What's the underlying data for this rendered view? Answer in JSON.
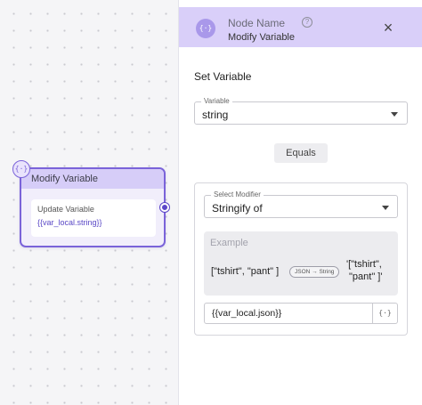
{
  "canvas": {
    "node": {
      "badge_icon": "{·}",
      "title": "Modify Variable",
      "body_label": "Update Variable",
      "body_value": "{{var_local.string}}"
    }
  },
  "panel": {
    "header": {
      "icon": "{·}",
      "title": "Node Name",
      "help_icon": "?",
      "subtitle": "Modify Variable",
      "close_icon": "×"
    },
    "section_title": "Set Variable",
    "variable_field": {
      "legend": "Variable",
      "value": "string"
    },
    "equals_label": "Equals",
    "modifier_field": {
      "legend": "Select Modifier",
      "value": "Stringify of"
    },
    "example": {
      "title": "Example",
      "input": "[\"tshirt\", \"pant\" ]",
      "transform": "JSON → String",
      "output_line1": "'[\"tshirt\",",
      "output_line2": "\"pant\" ]'"
    },
    "json_input_value": "{{var_local.json}}",
    "json_btn_icon": "{·}"
  },
  "colors": {
    "accent": "#7a63d9",
    "header_bg": "#d9cff9",
    "node_header_bg": "#d6cdf8"
  }
}
